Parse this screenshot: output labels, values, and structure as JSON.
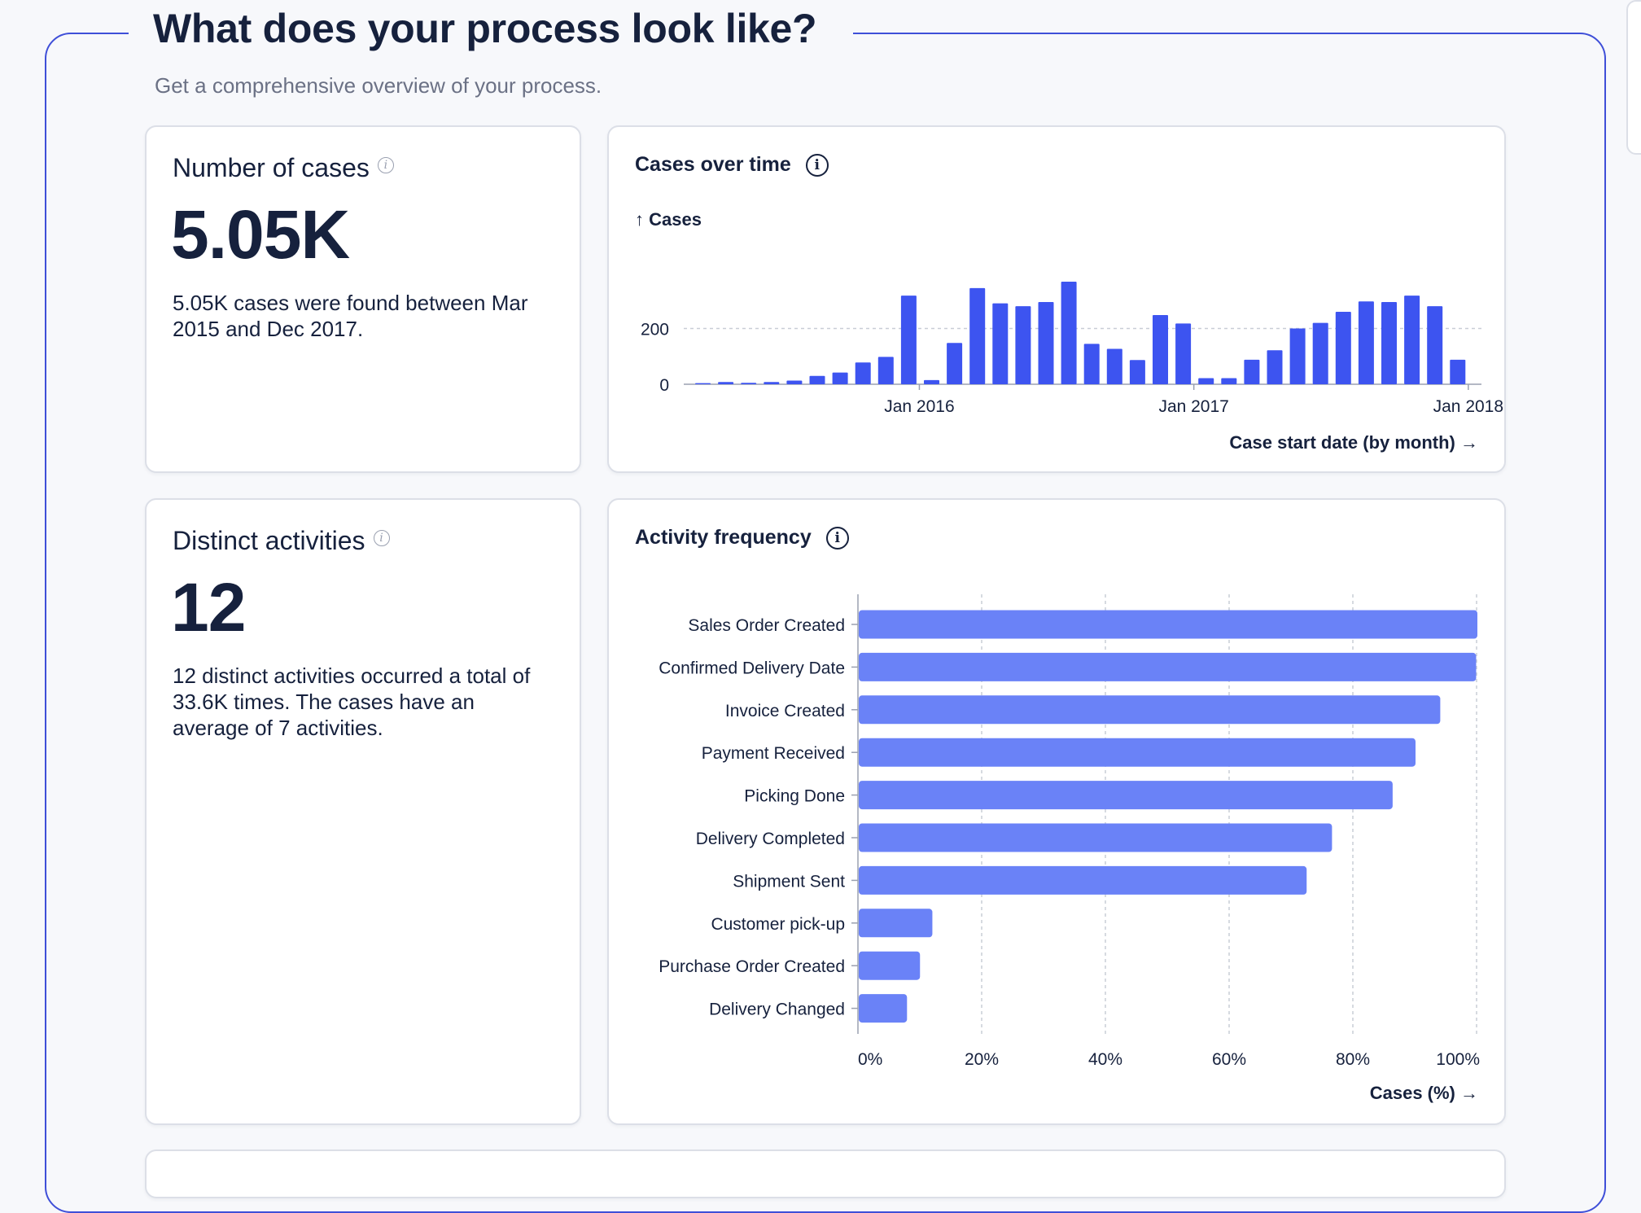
{
  "page": {
    "title": "What does your process look like?",
    "subtitle": "Get a comprehensive overview of your process."
  },
  "colors": {
    "accent": "#3f4fd8",
    "bar_time": "#3d54f0",
    "bar_activity": "#6a82f7",
    "text": "#16213d"
  },
  "cases_kpi": {
    "label": "Number of cases",
    "value": "5.05K",
    "description": "5.05K cases were found between Mar 2015 and Dec 2017.",
    "info_icon": "info-icon"
  },
  "distinct_kpi": {
    "label": "Distinct activities",
    "value": "12",
    "description": "12 distinct activities occurred a total of 33.6K times. The cases have an average of 7 activities.",
    "info_icon": "info-icon"
  },
  "cases_over_time": {
    "title": "Cases over time",
    "y_axis_label": "↑ Cases",
    "x_axis_label": "Case start date (by month) →"
  },
  "activity_frequency": {
    "title": "Activity frequency",
    "x_axis_label": "Cases (%) →"
  },
  "chart_data": [
    {
      "type": "bar",
      "title": "Cases over time",
      "ylabel": "Cases",
      "xlabel": "Case start date (by month)",
      "x_ticks": [
        "Jan 2016",
        "Jan 2017",
        "Jan 2018"
      ],
      "y_ticks": [
        0,
        200
      ],
      "grid": "dashed horizontal",
      "categories": [
        "Mar 2015",
        "Apr 2015",
        "May 2015",
        "Jun 2015",
        "Jul 2015",
        "Aug 2015",
        "Sep 2015",
        "Oct 2015",
        "Nov 2015",
        "Dec 2015",
        "Jan 2016",
        "Feb 2016",
        "Mar 2016",
        "Apr 2016",
        "May 2016",
        "Jun 2016",
        "Jul 2016",
        "Aug 2016",
        "Sep 2016",
        "Oct 2016",
        "Nov 2016",
        "Dec 2016",
        "Jan 2017",
        "Feb 2017",
        "Mar 2017",
        "Apr 2017",
        "May 2017",
        "Jun 2017",
        "Jul 2017",
        "Aug 2017",
        "Sep 2017",
        "Oct 2017",
        "Nov 2017",
        "Dec 2017"
      ],
      "values": [
        4,
        8,
        5,
        8,
        13,
        30,
        42,
        78,
        98,
        318,
        15,
        148,
        345,
        290,
        280,
        295,
        368,
        145,
        127,
        87,
        248,
        218,
        22,
        22,
        88,
        122,
        200,
        220,
        260,
        297,
        295,
        318,
        280,
        88
      ]
    },
    {
      "type": "bar",
      "orientation": "horizontal",
      "title": "Activity frequency",
      "xlabel": "Cases (%)",
      "x_ticks": [
        "0%",
        "20%",
        "40%",
        "60%",
        "80%",
        "100%"
      ],
      "xlim": [
        0,
        100
      ],
      "grid": "dashed vertical",
      "categories": [
        "Sales Order Created",
        "Confirmed Delivery Date",
        "Invoice Created",
        "Payment Received",
        "Picking Done",
        "Delivery Completed",
        "Shipment Sent",
        "Customer pick-up",
        "Purchase Order Created",
        "Delivery Changed"
      ],
      "values": [
        100,
        99.8,
        94,
        90,
        86.3,
        76.5,
        72.4,
        11.9,
        9.9,
        7.8
      ]
    }
  ]
}
